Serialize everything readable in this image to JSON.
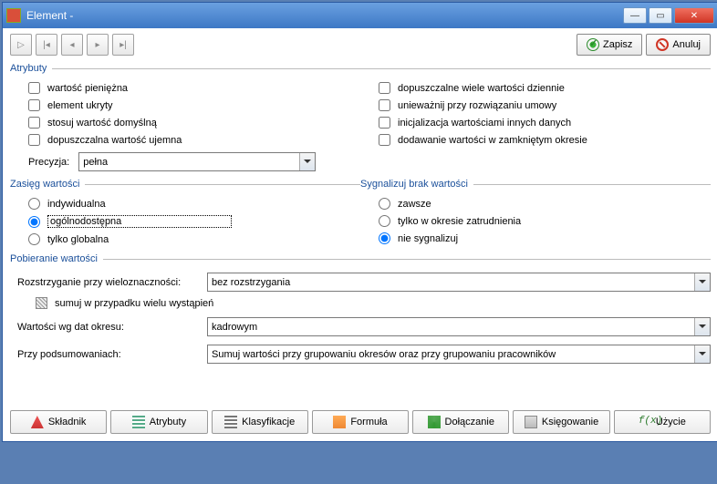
{
  "window": {
    "title": "Element -"
  },
  "toolbar": {
    "save": "Zapisz",
    "cancel": "Anuluj"
  },
  "attrs": {
    "legend": "Atrybuty",
    "left": [
      "wartość pieniężna",
      "element ukryty",
      "stosuj wartość domyślną",
      "dopuszczalna wartość ujemna"
    ],
    "right": [
      "dopuszczalne wiele wartości dziennie",
      "unieważnij przy rozwiązaniu umowy",
      "inicjalizacja wartościami innych danych",
      "dodawanie wartości w zamkniętym okresie"
    ],
    "precision_label": "Precyzja:",
    "precision_value": "pełna"
  },
  "scope": {
    "legend": "Zasięg wartości",
    "opts": [
      "indywidualna",
      "ogólnodostępna",
      "tylko globalna"
    ]
  },
  "signal": {
    "legend": "Sygnalizuj brak wartości",
    "opts": [
      "zawsze",
      "tylko w okresie zatrudnienia",
      "nie sygnalizuj"
    ]
  },
  "fetch": {
    "legend": "Pobieranie wartości",
    "ambig_label": "Rozstrzyganie przy wieloznaczności:",
    "ambig_value": "bez rozstrzygania",
    "sum_label": "sumuj w przypadku wielu wystąpień",
    "period_label": "Wartości wg dat okresu:",
    "period_value": "kadrowym",
    "summary_label": "Przy podsumowaniach:",
    "summary_value": "Sumuj wartości przy grupowaniu okresów oraz przy grupowaniu pracowników"
  },
  "tabs": [
    "Składnik",
    "Atrybuty",
    "Klasyfikacje",
    "Formuła",
    "Dołączanie",
    "Księgowanie",
    "Użycie"
  ]
}
